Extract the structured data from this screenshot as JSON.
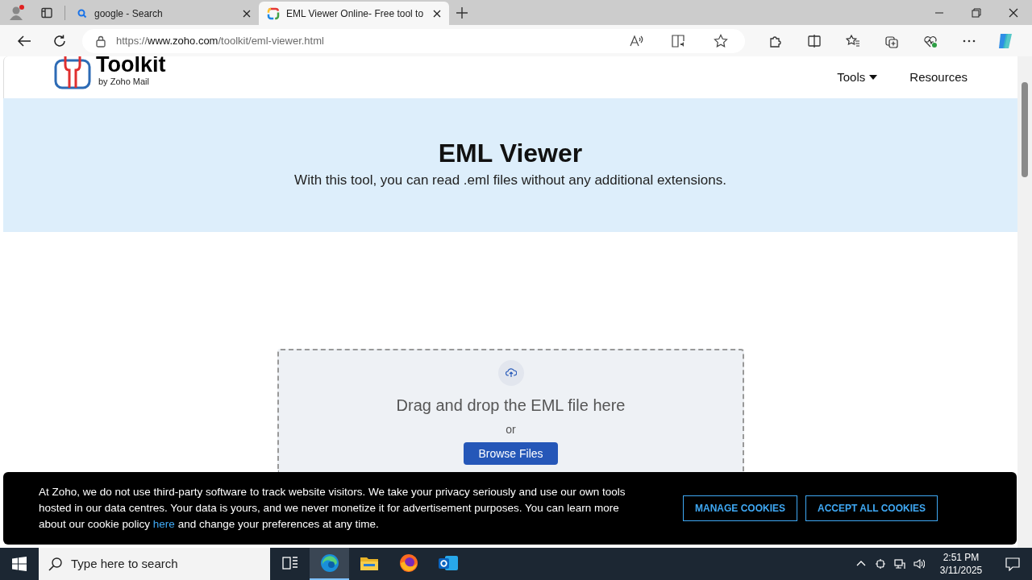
{
  "browser": {
    "tabs": [
      {
        "kind": "search",
        "title": "google - Search",
        "selected": false
      },
      {
        "kind": "page",
        "title": "EML Viewer Online- Free tool to",
        "selected": true
      }
    ],
    "url": {
      "scheme": "https://",
      "host": "www.zoho.com",
      "path": "/toolkit/eml-viewer.html"
    }
  },
  "header": {
    "logo_title": "Toolkit",
    "logo_subtitle": "by Zoho Mail",
    "nav": [
      {
        "label": "Tools",
        "dropdown": true
      },
      {
        "label": "Resources",
        "dropdown": false
      }
    ]
  },
  "hero": {
    "title": "EML Viewer",
    "subtitle": "With this tool, you can read .eml files without any additional extensions."
  },
  "dropzone": {
    "prompt": "Drag and drop the EML file here",
    "separator": "or",
    "button": "Browse Files"
  },
  "cookie_banner": {
    "text_before": "At Zoho, we do not use third-party software to track website visitors. We take your privacy seriously and use our own tools hosted in our data centres. Your data is yours, and we never monetize it for advertisement purposes. You can learn more about our cookie policy",
    "link": "here",
    "text_after": "and change your preferences at any time.",
    "buttons": [
      "MANAGE COOKIES",
      "ACCEPT ALL COOKIES"
    ]
  },
  "taskbar": {
    "search_placeholder": "Type here to search",
    "apps": [
      {
        "kind": "taskview",
        "active": false
      },
      {
        "kind": "edge",
        "active": true
      },
      {
        "kind": "files",
        "active": false
      },
      {
        "kind": "firefox",
        "active": false
      },
      {
        "kind": "outlook",
        "active": false
      }
    ],
    "time": "2:51 PM",
    "date": "3/11/2025"
  }
}
